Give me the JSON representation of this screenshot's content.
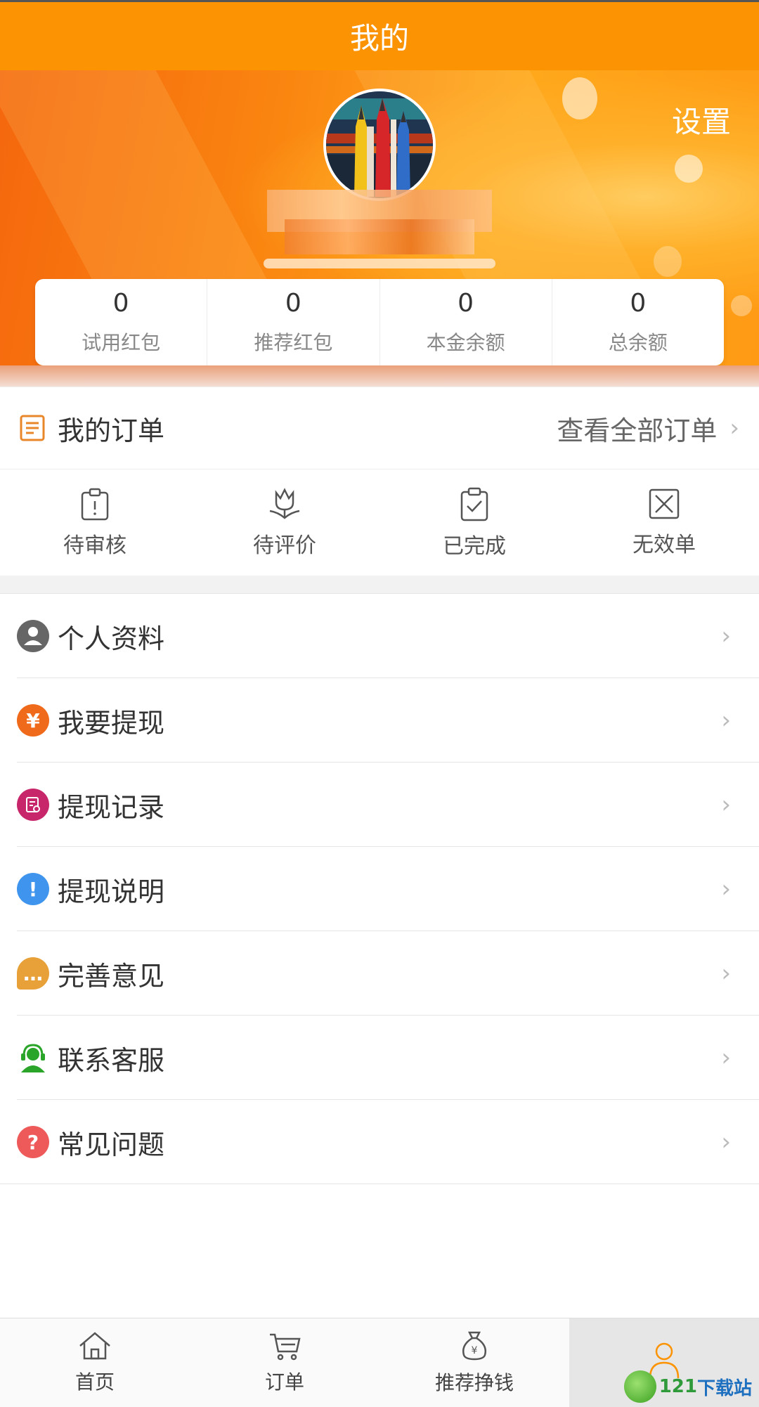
{
  "header": {
    "title": "我的"
  },
  "profile": {
    "settings_label": "设置"
  },
  "stats": [
    {
      "value": "0",
      "label": "试用红包"
    },
    {
      "value": "0",
      "label": "推荐红包"
    },
    {
      "value": "0",
      "label": "本金余额"
    },
    {
      "value": "0",
      "label": "总余额"
    }
  ],
  "orders": {
    "title": "我的订单",
    "view_all": "查看全部订单",
    "statuses": [
      {
        "label": "待审核",
        "icon": "clipboard-pending-icon"
      },
      {
        "label": "待评价",
        "icon": "tulip-icon"
      },
      {
        "label": "已完成",
        "icon": "clipboard-check-icon"
      },
      {
        "label": "无效单",
        "icon": "box-x-icon"
      }
    ]
  },
  "menu": [
    {
      "label": "个人资料",
      "icon": "person-icon",
      "color": "#666666"
    },
    {
      "label": "我要提现",
      "icon": "yuan-icon",
      "color": "#f06a1c"
    },
    {
      "label": "提现记录",
      "icon": "record-icon",
      "color": "#c8266b"
    },
    {
      "label": "提现说明",
      "icon": "info-icon",
      "color": "#3f94ee"
    },
    {
      "label": "完善意见",
      "icon": "chat-bubble-icon",
      "color": "#e8a038"
    },
    {
      "label": "联系客服",
      "icon": "headset-icon",
      "color": "#2aa52a"
    },
    {
      "label": "常见问题",
      "icon": "question-icon",
      "color": "#ee5a5a"
    }
  ],
  "tabbar": [
    {
      "label": "首页",
      "icon": "home-icon"
    },
    {
      "label": "订单",
      "icon": "cart-icon"
    },
    {
      "label": "推荐挣钱",
      "icon": "money-bag-icon"
    },
    {
      "label": "",
      "icon": "user-icon",
      "active": true
    }
  ],
  "watermark": {
    "text_a": "121",
    "text_b": "下载站"
  },
  "colors": {
    "accent": "#fb9302"
  }
}
